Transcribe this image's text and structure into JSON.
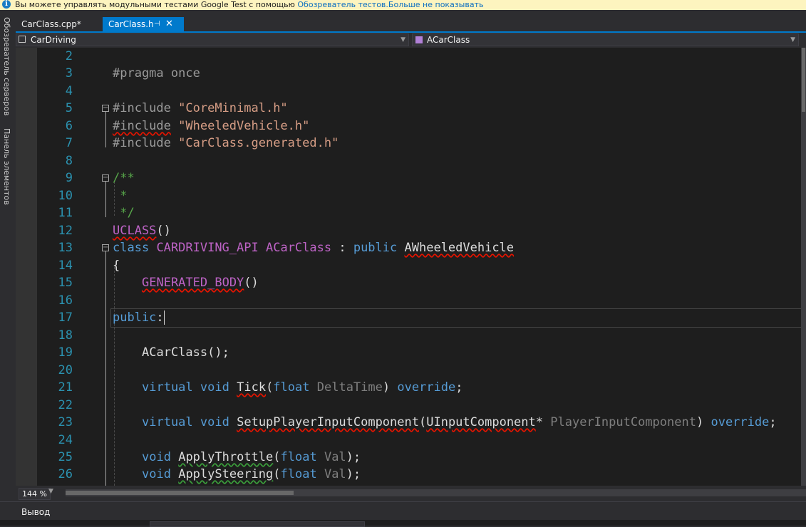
{
  "infobar": {
    "message": "Вы можете управлять модульными тестами Google Test с помощью ",
    "link1": "Обозреватель тестов.",
    "link2": "Больше не показывать"
  },
  "side_tabs": [
    "Обозреватель серверов",
    "Панель элементов"
  ],
  "tabs": [
    {
      "label": "CarClass.cpp*",
      "active": false
    },
    {
      "label": "CarClass.h",
      "active": true
    }
  ],
  "navbar": {
    "project": "CarDriving",
    "scope": "ACarClass"
  },
  "editor": {
    "line_numbers": [
      "2",
      "3",
      "4",
      "5",
      "6",
      "7",
      "8",
      "9",
      "10",
      "11",
      "12",
      "13",
      "14",
      "15",
      "16",
      "17",
      "18",
      "19",
      "20",
      "21",
      "22",
      "23",
      "24",
      "25",
      "26"
    ],
    "lines": {
      "l3": {
        "pragma": "#pragma once"
      },
      "l5": {
        "directive": "#include",
        "file": "\"CoreMinimal.h\""
      },
      "l6": {
        "directive": "#include",
        "file": "\"WheeledVehicle.h\""
      },
      "l7": {
        "directive": "#include",
        "file": "\"CarClass.generated.h\""
      },
      "l9": "/**",
      "l10": " *",
      "l11": " */",
      "l12": {
        "macro": "UCLASS",
        "rest": "()"
      },
      "l13": {
        "kw": "class",
        "api": "CARDRIVING_API",
        "name": "ACarClass",
        "colon": " : ",
        "pub": "public",
        "base": "AWheeledVehicle"
      },
      "l14": "{",
      "l15": {
        "macro": "GENERATED_BODY",
        "rest": "()"
      },
      "l17": {
        "kw": "public",
        "colon": ":"
      },
      "l19": "ACarClass();",
      "l21": {
        "kw1": "virtual",
        "kw2": "void",
        "fn": "Tick",
        "open": "(",
        "ptype": "float",
        "pname": "DeltaTime",
        "close": ")",
        "ovr": "override",
        "end": ";"
      },
      "l23": {
        "kw1": "virtual",
        "kw2": "void",
        "fn": "SetupPlayerInputComponent",
        "open": "(",
        "ptype": "UInputComponent",
        "star": "*",
        "pname": "PlayerInputComponent",
        "close": ")",
        "ovr": "override",
        "end": ";"
      },
      "l25": {
        "kw": "void",
        "fn": "ApplyThrottle",
        "open": "(",
        "ptype": "float",
        "pname": "Val",
        "close": ");"
      },
      "l26": {
        "kw": "void",
        "fn": "ApplySteering",
        "open": "(",
        "ptype": "float",
        "pname": "Val",
        "close": ");"
      }
    }
  },
  "status": {
    "zoom": "144 %"
  },
  "output": {
    "title": "Вывод"
  },
  "colors": {
    "accent": "#007acc",
    "editor_bg": "#1e1e1e",
    "keyword": "#569cd6",
    "string": "#d69d85",
    "comment": "#57a64a",
    "macro": "#bd63c5",
    "line_number": "#2b91af"
  }
}
